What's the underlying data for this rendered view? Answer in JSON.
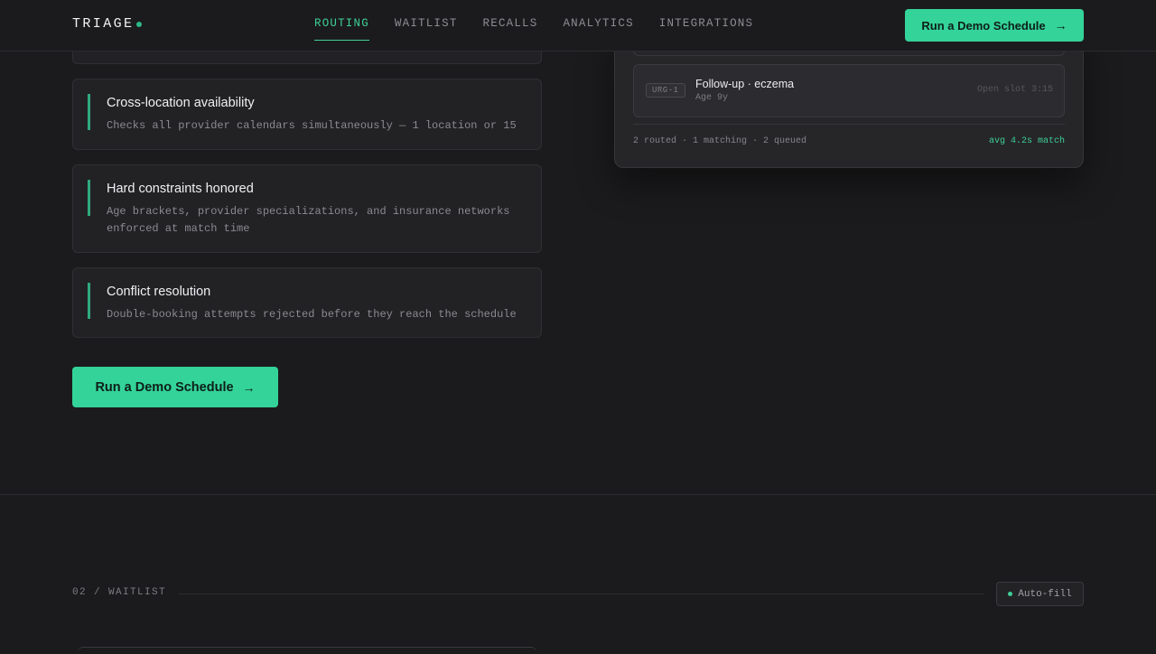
{
  "nav": {
    "logo": "TRIAGE",
    "links": [
      "ROUTING",
      "WAITLIST",
      "RECALLS",
      "ANALYTICS",
      "INTEGRATIONS"
    ],
    "cta": "Run a Demo Schedule"
  },
  "features": [
    {
      "title": "Cross-location availability",
      "desc": "Checks all provider calendars simultaneously — 1 location or 15"
    },
    {
      "title": "Hard constraints honored",
      "desc": "Age brackets, provider specializations, and insurance networks enforced at match time"
    },
    {
      "title": "Conflict resolution",
      "desc": "Double-booking attempts rejected before they reach the schedule"
    }
  ],
  "main_cta": "Run a Demo Schedule",
  "panel": {
    "row": {
      "tag": "URG-1",
      "name": "Follow-up · eczema",
      "sub": "Age 9y",
      "slot": "Open slot 3:15"
    },
    "footer": "2 routed · 1 matching · 2 queued",
    "avg": "avg 4.2s match"
  },
  "section": {
    "label": "02 / WAITLIST",
    "badge": "Auto-fill"
  },
  "colors": {
    "accent": "#34d399",
    "background": "#1b1b1d"
  },
  "icons": {
    "cta": "arrow-right-icon"
  }
}
